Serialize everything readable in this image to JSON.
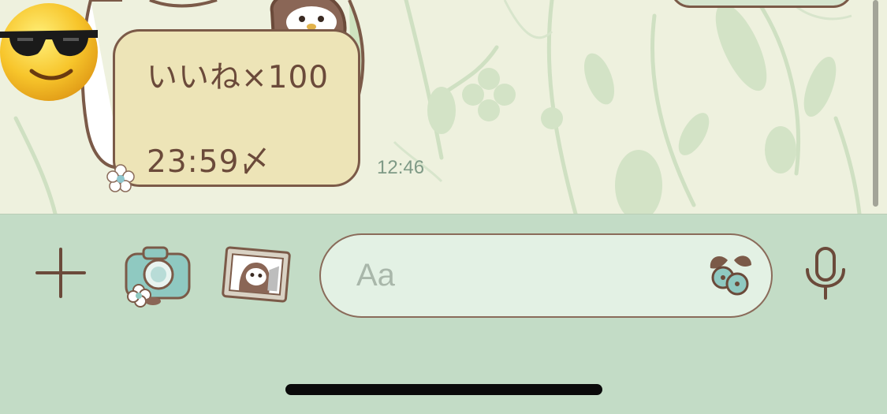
{
  "chat": {
    "message_lines": [
      "いいね×100",
      "23:59〆"
    ],
    "timestamp": "12:46"
  },
  "composer": {
    "placeholder": "Aa"
  },
  "icons": {
    "plus": "plus-icon",
    "camera": "camera-icon",
    "gallery": "photo-gallery-icon",
    "emoji": "leaf-berry-emoji-icon",
    "mic": "microphone-icon",
    "avatar": "sunglasses-emoji-avatar"
  },
  "colors": {
    "chat_background": "#eef1de",
    "toolbar_background": "#c3dcc6",
    "bubble_fill": "#ede4b7",
    "bubble_border": "#7b5a48",
    "text_brown": "#6b4a3a",
    "input_fill": "#e3f1e4"
  }
}
